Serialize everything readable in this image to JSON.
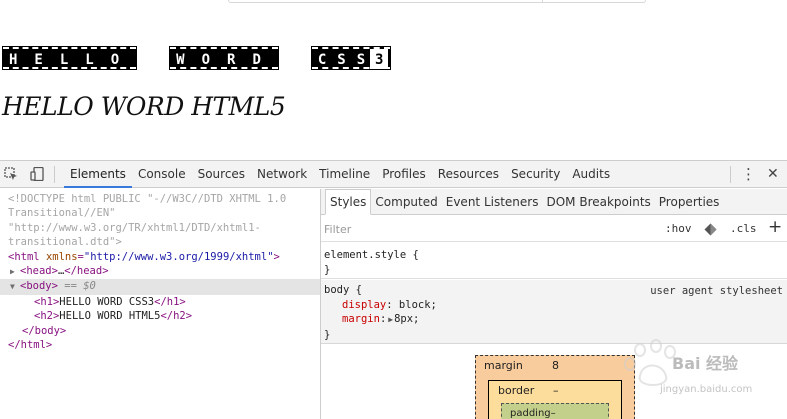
{
  "page": {
    "h1_words": [
      "HELLO",
      "WORD",
      "CSS"
    ],
    "h1_digit": "3",
    "h2_text": "HELLO WORD HTML5"
  },
  "devtools": {
    "toolbar": {
      "tabs": [
        {
          "label": "Elements",
          "active": true
        },
        {
          "label": "Console"
        },
        {
          "label": "Sources"
        },
        {
          "label": "Network"
        },
        {
          "label": "Timeline"
        },
        {
          "label": "Profiles"
        },
        {
          "label": "Resources"
        },
        {
          "label": "Security"
        },
        {
          "label": "Audits"
        }
      ],
      "menu_glyph": "⋮",
      "close_glyph": "✕",
      "accent_color": "#3879d9"
    },
    "dom": {
      "doctype_1": "<!DOCTYPE html PUBLIC \"-//W3C//DTD XHTML 1.0",
      "doctype_2": "Transitional//EN\"",
      "doctype_3": "\"http://www.w3.org/TR/xhtml1/DTD/xhtml1-",
      "doctype_4": "transitional.dtd\">",
      "html_open_tag": "<html",
      "html_attr_name": "xmlns",
      "html_attr_eq": "=",
      "html_attr_value": "\"http://www.w3.org/1999/xhtml\"",
      "html_open_close": ">",
      "head_open": "<head>",
      "head_ellipsis": "…",
      "head_close": "</head>",
      "body_open": "<body>",
      "body_selected_marker": "== $0",
      "h1_open": "<h1>",
      "h1_text": "HELLO WORD CSS3",
      "h1_close": "</h1>",
      "h2_open": "<h2>",
      "h2_text": "HELLO WORD HTML5",
      "h2_close": "</h2>",
      "body_close": "</body>",
      "html_close": "</html>"
    },
    "styles": {
      "tabs": [
        {
          "label": "Styles",
          "active": true
        },
        {
          "label": "Computed"
        },
        {
          "label": "Event Listeners"
        },
        {
          "label": "DOM Breakpoints"
        },
        {
          "label": "Properties"
        }
      ],
      "filter_placeholder": "Filter",
      "hov_label": ":hov",
      "cls_label": ".cls",
      "plus_label": "+",
      "rule1_selector": "element.style {",
      "rule1_close": "}",
      "rule2_selector": "body {",
      "rule2_origin": "user agent stylesheet",
      "rule2_prop1_name": "display",
      "rule2_prop1_value": "block;",
      "rule2_prop2_name": "margin",
      "rule2_prop2_value": "8px;",
      "rule2_close": "}",
      "boxmodel": {
        "margin_label": "margin",
        "margin_value": "8",
        "border_label": "border",
        "border_value": "–",
        "padding_label": "padding–"
      }
    }
  },
  "watermark": {
    "text": "Bai 经验",
    "url": "jingyan.baidu.com"
  }
}
